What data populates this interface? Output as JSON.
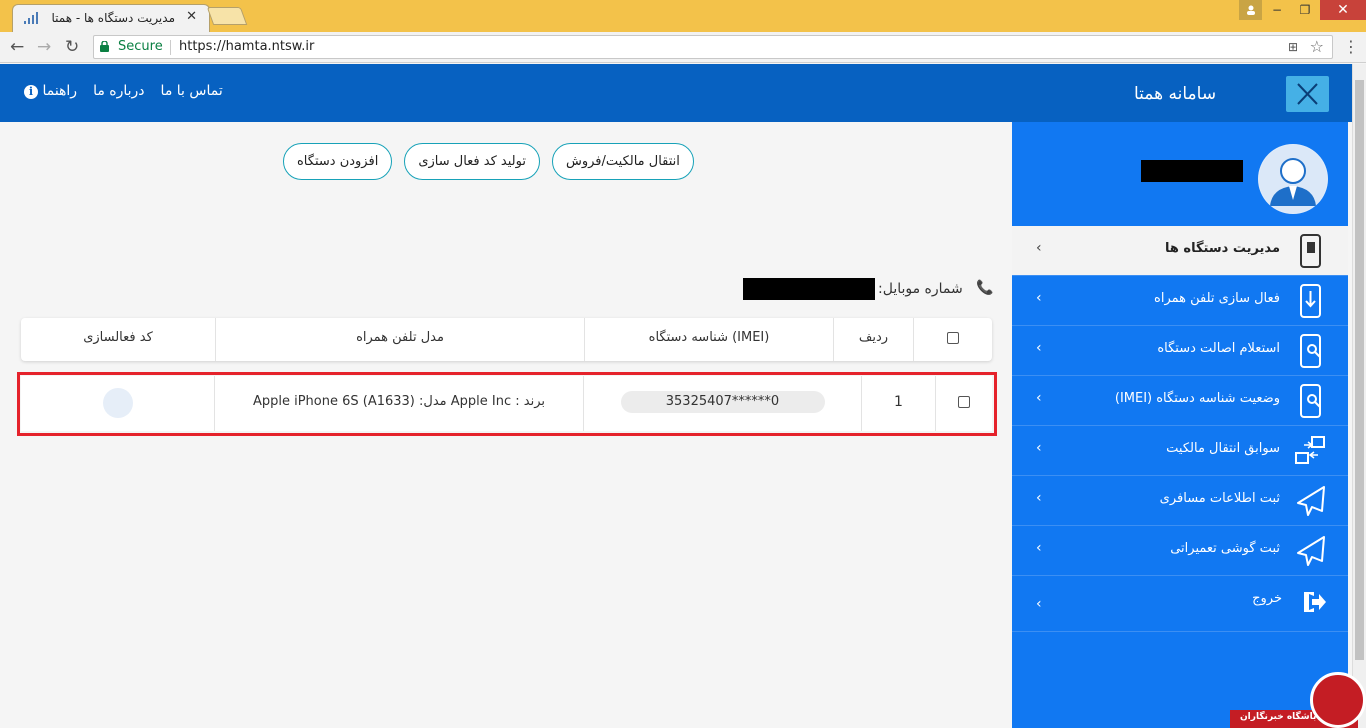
{
  "browser": {
    "tab_title": "مدیریت دستگاه ها - همتا",
    "tab_close": "✕",
    "secure_label": "Secure",
    "url": "https://hamta.ntsw.ir",
    "back": "←",
    "forward": "→",
    "reload": "↻",
    "star": "☆",
    "menu": "⋮",
    "translate": "⊞",
    "win_min": "−",
    "win_max": "❐",
    "win_close": "✕"
  },
  "header": {
    "brand": "سامانه همتا",
    "links": {
      "help": "راهنما",
      "about": "درباره ما",
      "contact": "تماس با ما"
    },
    "info_icon": "i"
  },
  "actions": {
    "transfer": "انتقال مالکیت/فروش",
    "generate_code": "تولید کد فعال سازی",
    "add_device": "افزودن دستگاه"
  },
  "mobile": {
    "label": "شماره موبایل:",
    "phone_icon": "📞"
  },
  "table": {
    "headers": {
      "row": "ردیف",
      "imei": "شناسه دستگاه (IMEI)",
      "model": "مدل تلفن همراه",
      "code": "کد فعالسازی"
    },
    "rows": [
      {
        "index": "1",
        "imei": "35325407******0",
        "model": "برند : Apple Inc مدل: Apple iPhone 6S (A1633)"
      }
    ]
  },
  "sidebar": {
    "items": [
      {
        "label": "مدیریت دستگاه ها",
        "icon": "phone-sim-icon",
        "active": true
      },
      {
        "label": "فعال سازی تلفن همراه",
        "icon": "phone-download-icon"
      },
      {
        "label": "استعلام اصالت دستگاه",
        "icon": "phone-search-icon"
      },
      {
        "label": "وضعیت شناسه دستگاه (IMEI)",
        "icon": "phone-search-icon"
      },
      {
        "label": "سوابق انتقال مالکیت",
        "icon": "transfer-icon"
      },
      {
        "label": "ثبت اطلاعات مسافری",
        "icon": "airplane-icon"
      },
      {
        "label": "ثبت گوشی تعمیراتی",
        "icon": "airplane-icon"
      },
      {
        "label": "خروج",
        "icon": "logout-icon"
      }
    ],
    "chevron": "‹"
  },
  "watermark": {
    "text": "باشگاه خبرنگاران"
  },
  "colors": {
    "header": "#0761c1",
    "sidebar": "#1178f2",
    "highlight": "#e5222b",
    "button_border": "#17a2b8"
  }
}
